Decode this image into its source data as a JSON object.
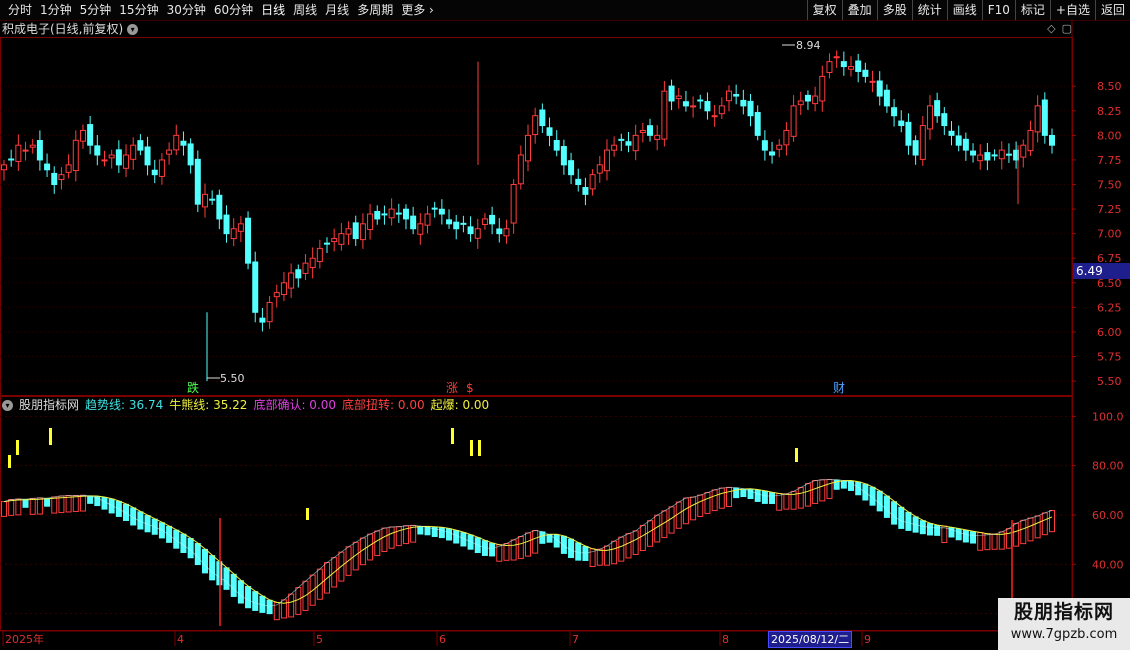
{
  "toolbar": {
    "periods": [
      "分时",
      "1分钟",
      "5分钟",
      "15分钟",
      "30分钟",
      "60分钟",
      "日线",
      "周线",
      "月线",
      "多周期",
      "更多 ›"
    ],
    "active_period": "日线",
    "buttons": [
      "复权",
      "叠加",
      "多股",
      "统计",
      "画线",
      "F10",
      "标记",
      "+自选",
      "返回"
    ]
  },
  "price_panel": {
    "title": "积成电子(日线,前复权)",
    "y_ticks": [
      "8.50",
      "8.25",
      "8.00",
      "7.75",
      "7.50",
      "7.25",
      "7.00",
      "6.75",
      "6.50",
      "6.25",
      "6.00",
      "5.75",
      "5.50"
    ],
    "current_price": "6.49",
    "high_label": "8.94",
    "low_label": "5.50",
    "markers": {
      "die": "跌",
      "zhang": "涨",
      "dollar": "$",
      "cai": "财"
    }
  },
  "indicator_panel": {
    "name": "股朋指标网",
    "fields": [
      {
        "label": "趋势线:",
        "value": "36.74",
        "color": "#3fe0e0"
      },
      {
        "label": "牛熊线:",
        "value": "35.22",
        "color": "#f0f040"
      },
      {
        "label": "底部确认:",
        "value": "0.00",
        "color": "#e040e0"
      },
      {
        "label": "底部扭转:",
        "value": "0.00",
        "color": "#ff4040"
      },
      {
        "label": "起爆:",
        "value": "0.00",
        "color": "#f0f040"
      }
    ],
    "y_ticks": [
      "100.0",
      "80.00",
      "60.00",
      "40.00",
      "20.00"
    ]
  },
  "time_axis": {
    "labels": [
      "2025年",
      "4",
      "5",
      "6",
      "7",
      "8",
      "9"
    ],
    "selected_date": "2025/08/12/二"
  },
  "watermark": {
    "title": "股朋指标网",
    "url": "www.7gpzb.com"
  },
  "colors": {
    "up": "#ff3c3c",
    "down": "#54ffff",
    "trend": "#54ffff",
    "bull_bear": "#f0f040",
    "grid": "#5a0000"
  },
  "chart_data": {
    "type": "candlestick",
    "price_range": [
      5.45,
      8.95
    ],
    "candles_close_approx": [
      7.7,
      7.75,
      7.9,
      7.85,
      7.9,
      7.75,
      7.65,
      7.5,
      7.6,
      7.7,
      7.95,
      8.05,
      7.9,
      7.8,
      7.75,
      7.8,
      7.7,
      7.8,
      7.9,
      7.85,
      7.7,
      7.6,
      7.75,
      7.85,
      8.0,
      7.9,
      7.7,
      7.3,
      7.4,
      7.35,
      7.15,
      7.0,
      7.05,
      7.1,
      6.7,
      6.2,
      6.1,
      6.3,
      6.4,
      6.5,
      6.6,
      6.55,
      6.7,
      6.75,
      6.85,
      6.9,
      6.95,
      7.0,
      7.05,
      6.95,
      7.1,
      7.2,
      7.15,
      7.2,
      7.25,
      7.2,
      7.15,
      7.05,
      7.1,
      7.2,
      7.25,
      7.2,
      7.1,
      7.05,
      7.1,
      7.0,
      7.05,
      7.15,
      7.1,
      7.0,
      7.05,
      7.5,
      7.8,
      8.0,
      8.2,
      8.1,
      8.0,
      7.85,
      7.7,
      7.6,
      7.5,
      7.4,
      7.6,
      7.7,
      7.85,
      7.9,
      7.95,
      7.9,
      8.0,
      8.05,
      8.0,
      8.0,
      8.45,
      8.35,
      8.4,
      8.3,
      8.3,
      8.35,
      8.25,
      8.2,
      8.3,
      8.45,
      8.4,
      8.3,
      8.2,
      8.0,
      7.85,
      7.8,
      7.9,
      8.05,
      8.3,
      8.35,
      8.35,
      8.4,
      8.6,
      8.75,
      8.8,
      8.7,
      8.7,
      8.65,
      8.6,
      8.55,
      8.4,
      8.3,
      8.2,
      8.1,
      7.9,
      7.8,
      8.1,
      8.3,
      8.2,
      8.1,
      8.0,
      7.9,
      7.85,
      7.8,
      7.8,
      7.75,
      7.8,
      7.85,
      7.8,
      7.75,
      7.9,
      8.05,
      8.3,
      8.0,
      7.9
    ],
    "indicator": {
      "trend_line_last": 36.74,
      "bull_bear_line_last": 35.22,
      "range": [
        15,
        105
      ]
    }
  }
}
